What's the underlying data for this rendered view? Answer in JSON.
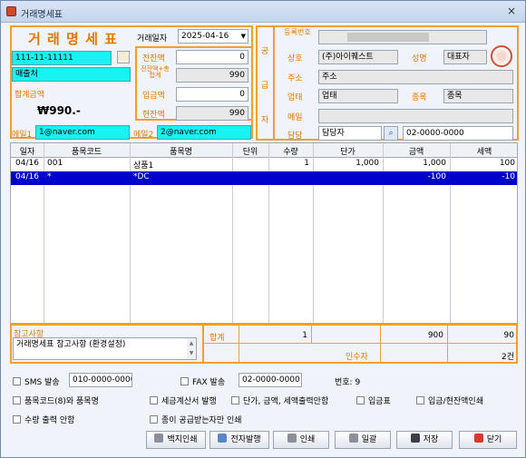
{
  "window": {
    "title": "거래명세표",
    "close": "×"
  },
  "header": {
    "doc_title": "거 래 명 세 표",
    "date_label": "거래일자",
    "date_value": "2025-04-16",
    "biz_no": "111-11-11111",
    "buyer_name": "매출처",
    "total_label": "합계금액",
    "total_value": "₩990.-"
  },
  "balances": {
    "prev_label": "전잔액",
    "prev_value": "0",
    "prev_total_label": "전잔액+총합계",
    "prev_total_value": "990",
    "payment_label": "입금액",
    "payment_value": "0",
    "current_label": "현잔액",
    "current_value": "990"
  },
  "email": {
    "label1": "메일1",
    "value1": "1@naver.com",
    "label2": "메일2",
    "value2": "2@naver.com"
  },
  "supplier": {
    "vertical_label": [
      "공",
      "급",
      "자"
    ],
    "reg_label": "등록번호",
    "reg_value": "",
    "company_label": "상호",
    "company_value": "(주)아이퀘스트",
    "rep_label": "성명",
    "rep_value": "대표자",
    "addr_label": "주소",
    "addr_value": "주소",
    "biz_type_label": "업태",
    "biz_type_value": "업태",
    "item_label": "종목",
    "item_value": "종목",
    "mail_label": "메일",
    "mail_value": "",
    "contact_label": "담당",
    "contact_value": "담당자",
    "phone_value": "02-0000-0000"
  },
  "table": {
    "columns": [
      "일자",
      "품목코드",
      "품목명",
      "단위",
      "수량",
      "단가",
      "금액",
      "세액"
    ],
    "rows": [
      [
        "04/16",
        "001",
        "상품1",
        "",
        "1",
        "1,000",
        "1,000",
        "100"
      ],
      [
        "04/16",
        "*",
        "*DC",
        "",
        "",
        "",
        "-100",
        "-10"
      ]
    ]
  },
  "footer": {
    "memo_label": "참고사항",
    "memo_text": "거래명세표 참고사항 (환경설정)",
    "sum_label": "합계",
    "sum_qty": "1",
    "sum_amount": "900",
    "sum_tax": "90",
    "receiver_label": "인수자",
    "count": "2건"
  },
  "options": {
    "sms_label": "SMS 발송",
    "sms_number": "010-0000-0000",
    "fax_label": "FAX 발송",
    "fax_number": "02-0000-0000",
    "number_text": "번호: 9",
    "opt_code_name": "품목코드(8)와 품목명",
    "opt_tax_invoice": "세금계산서 발행",
    "opt_price_print": "단가, 금액, 세액출력안함",
    "opt_deposit": "입금표",
    "opt_deposit_balance": "입금/현잔액인쇄",
    "opt_qty_print": "수량 출력 안함",
    "opt_paper_only": "종이 공급받는자만 인쇄"
  },
  "buttons": {
    "blank_print": "백지인쇄",
    "e_issue": "전자발행",
    "print": "인쇄",
    "bulk": "일괄",
    "save": "저장",
    "close": "닫기"
  }
}
